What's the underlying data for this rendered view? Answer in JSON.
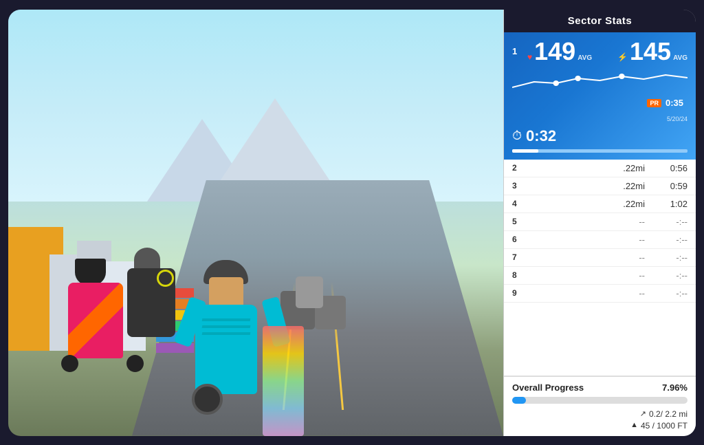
{
  "panel": {
    "title": "Sector Stats",
    "sector1": {
      "num": "1",
      "heart_avg": "149",
      "heart_label": "AVG",
      "power_avg": "145",
      "power_label": "AVG",
      "pr_badge": "PR",
      "pr_time": "0:35",
      "pr_date": "5/20/24",
      "current_time": "0:32",
      "progress_pct": 15
    },
    "sector_rows": [
      {
        "num": "2",
        "dist": ".22mi",
        "time": "0:56",
        "empty": false
      },
      {
        "num": "3",
        "dist": ".22mi",
        "time": "0:59",
        "empty": false
      },
      {
        "num": "4",
        "dist": ".22mi",
        "time": "1:02",
        "empty": false
      },
      {
        "num": "5",
        "dist": "--",
        "time": "-:--",
        "empty": true
      },
      {
        "num": "6",
        "dist": "--",
        "time": "-:--",
        "empty": true
      },
      {
        "num": "7",
        "dist": "--",
        "time": "-:--",
        "empty": true
      },
      {
        "num": "8",
        "dist": "--",
        "time": "-:--",
        "empty": true
      },
      {
        "num": "9",
        "dist": "--",
        "time": "-:--",
        "empty": true
      }
    ],
    "overall_progress": {
      "label": "Overall Progress",
      "pct": "7.96%",
      "dist": "0.2/ 2.2 mi",
      "elevation": "45 / 1000 FT",
      "bar_fill_pct": 7.96
    }
  }
}
